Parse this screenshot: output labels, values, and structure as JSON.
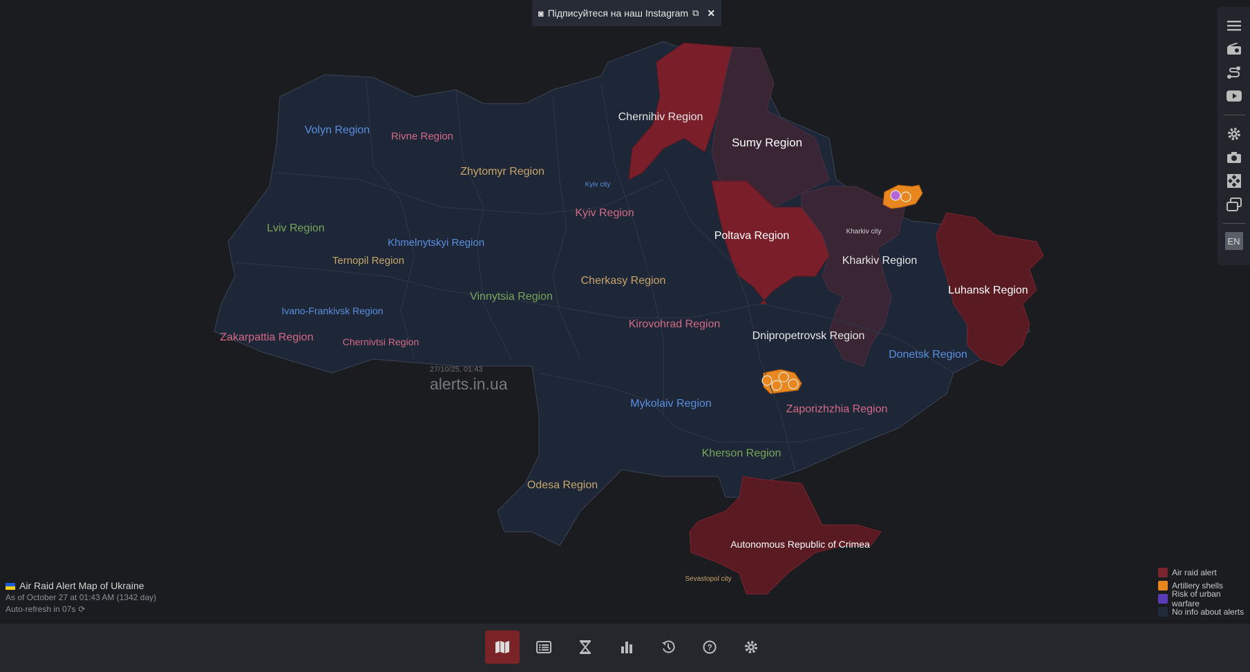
{
  "banner": {
    "text": "Підписуйтеся на наш Instagram"
  },
  "map": {
    "watermark_time": "27/10/25, 01:43",
    "watermark_site": "alerts.in.ua",
    "regions": [
      {
        "id": "volyn",
        "name": "Volyn Region",
        "status": "none",
        "color": "#5b8fe0"
      },
      {
        "id": "rivne",
        "name": "Rivne Region",
        "status": "none",
        "color": "#d46a86"
      },
      {
        "id": "zhytomyr",
        "name": "Zhytomyr Region",
        "status": "none",
        "color": "#c9a46b"
      },
      {
        "id": "chernihiv",
        "name": "Chernihiv Region",
        "status": "air_raid_partial",
        "color": "#e6e6e6"
      },
      {
        "id": "sumy",
        "name": "Sumy Region",
        "status": "air_raid_partial",
        "color": "#ffffff"
      },
      {
        "id": "kyiv_city",
        "name": "Kyiv city",
        "status": "none",
        "color": "#5b8fe0"
      },
      {
        "id": "kyiv",
        "name": "Kyiv Region",
        "status": "none",
        "color": "#d46a86"
      },
      {
        "id": "lviv",
        "name": "Lviv Region",
        "status": "none",
        "color": "#7ba65a"
      },
      {
        "id": "khmelnytskyi",
        "name": "Khmelnytskyi Region",
        "status": "none",
        "color": "#5b8fe0"
      },
      {
        "id": "ternopil",
        "name": "Ternopil Region",
        "status": "none",
        "color": "#c9a46b"
      },
      {
        "id": "poltava",
        "name": "Poltava Region",
        "status": "air_raid_partial",
        "color": "#ffffff"
      },
      {
        "id": "kharkiv_city",
        "name": "Kharkiv city",
        "status": "air_raid",
        "color": "#d0d0d0"
      },
      {
        "id": "kharkiv",
        "name": "Kharkiv Region",
        "status": "air_raid_partial",
        "color": "#e6e6e6"
      },
      {
        "id": "luhansk",
        "name": "Luhansk Region",
        "status": "air_raid",
        "color": "#ffffff"
      },
      {
        "id": "cherkasy",
        "name": "Cherkasy Region",
        "status": "none",
        "color": "#c9a46b"
      },
      {
        "id": "vinnytsia",
        "name": "Vinnytsia Region",
        "status": "none",
        "color": "#7ba65a"
      },
      {
        "id": "ivano_frankivsk",
        "name": "Ivano-Frankivsk Region",
        "status": "none",
        "color": "#5b8fe0"
      },
      {
        "id": "zakarpattia",
        "name": "Zakarpattia Region",
        "status": "none",
        "color": "#d46a86"
      },
      {
        "id": "chernivtsi",
        "name": "Chernivtsi Region",
        "status": "none",
        "color": "#d46a86"
      },
      {
        "id": "kirovohrad",
        "name": "Kirovohrad Region",
        "status": "none",
        "color": "#d46a86"
      },
      {
        "id": "dnipropetrovsk",
        "name": "Dnipropetrovsk Region",
        "status": "none",
        "color": "#e6e6e6"
      },
      {
        "id": "donetsk",
        "name": "Donetsk Region",
        "status": "none",
        "color": "#5b8fe0"
      },
      {
        "id": "mykolaiv",
        "name": "Mykolaiv Region",
        "status": "none",
        "color": "#5b8fe0"
      },
      {
        "id": "zaporizhzhia",
        "name": "Zaporizhzhia Region",
        "status": "none",
        "color": "#d46a86"
      },
      {
        "id": "kherson",
        "name": "Kherson Region",
        "status": "none",
        "color": "#7ba65a"
      },
      {
        "id": "odesa",
        "name": "Odesa Region",
        "status": "none",
        "color": "#c9a46b"
      },
      {
        "id": "crimea",
        "name": "Autonomous Republic of Crimea",
        "status": "air_raid",
        "color": "#ffffff"
      },
      {
        "id": "sevastopol",
        "name": "Sevastopol city",
        "status": "none",
        "color": "#c9a46b"
      }
    ]
  },
  "info": {
    "title": "Air Raid Alert Map of Ukraine",
    "as_of": "As of October 27 at 01:43 AM (1342 day)",
    "refresh": "Auto-refresh in 07s"
  },
  "legend": [
    {
      "label": "Air raid alert",
      "color": "#7a2430"
    },
    {
      "label": "Artillery shells",
      "color": "#e8861f"
    },
    {
      "label": "Risk of urban warfare",
      "color": "#5a3bb8"
    },
    {
      "label": "No info about alerts",
      "color": "#222b3b"
    }
  ],
  "right_toolbar": {
    "icons": [
      "menu-icon",
      "radio-icon",
      "route-icon",
      "youtube-icon",
      "settings-icon",
      "camera-icon",
      "fullscreen-icon",
      "window-icon"
    ],
    "lang": "EN"
  },
  "bottom_nav": {
    "icons": [
      "map-icon",
      "list-icon",
      "hourglass-icon",
      "chart-icon",
      "history-icon",
      "help-icon",
      "gear-icon"
    ],
    "active": "map-icon"
  },
  "colors": {
    "no_info": "#1d2737",
    "air_raid": "#7a1f2a",
    "air_raid_dark": "#5a1a22",
    "partial": "#3a2535",
    "artillery": "#e8861f",
    "border": "#3b4556"
  }
}
